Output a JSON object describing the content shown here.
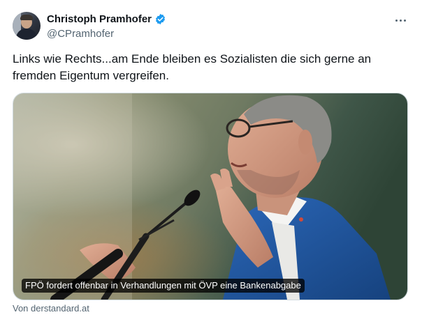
{
  "author": {
    "display_name": "Christoph Pramhofer",
    "handle": "@CPramhofer",
    "verified": true
  },
  "tweet": {
    "text": "Links wie Rechts...am Ende bleiben es Sozialisten die sich gerne an fremden Eigentum vergreifen."
  },
  "card": {
    "caption": "FPÖ fordert offenbar in Verhandlungen mit ÖVP eine Bankenabgabe",
    "source": "Von derstandard.at"
  },
  "colors": {
    "verified_badge": "#1d9bf0",
    "secondary_text": "#536471",
    "border": "#cfd9de"
  },
  "icons": {
    "more": "more-dots-icon",
    "verified": "verified-badge-icon"
  }
}
